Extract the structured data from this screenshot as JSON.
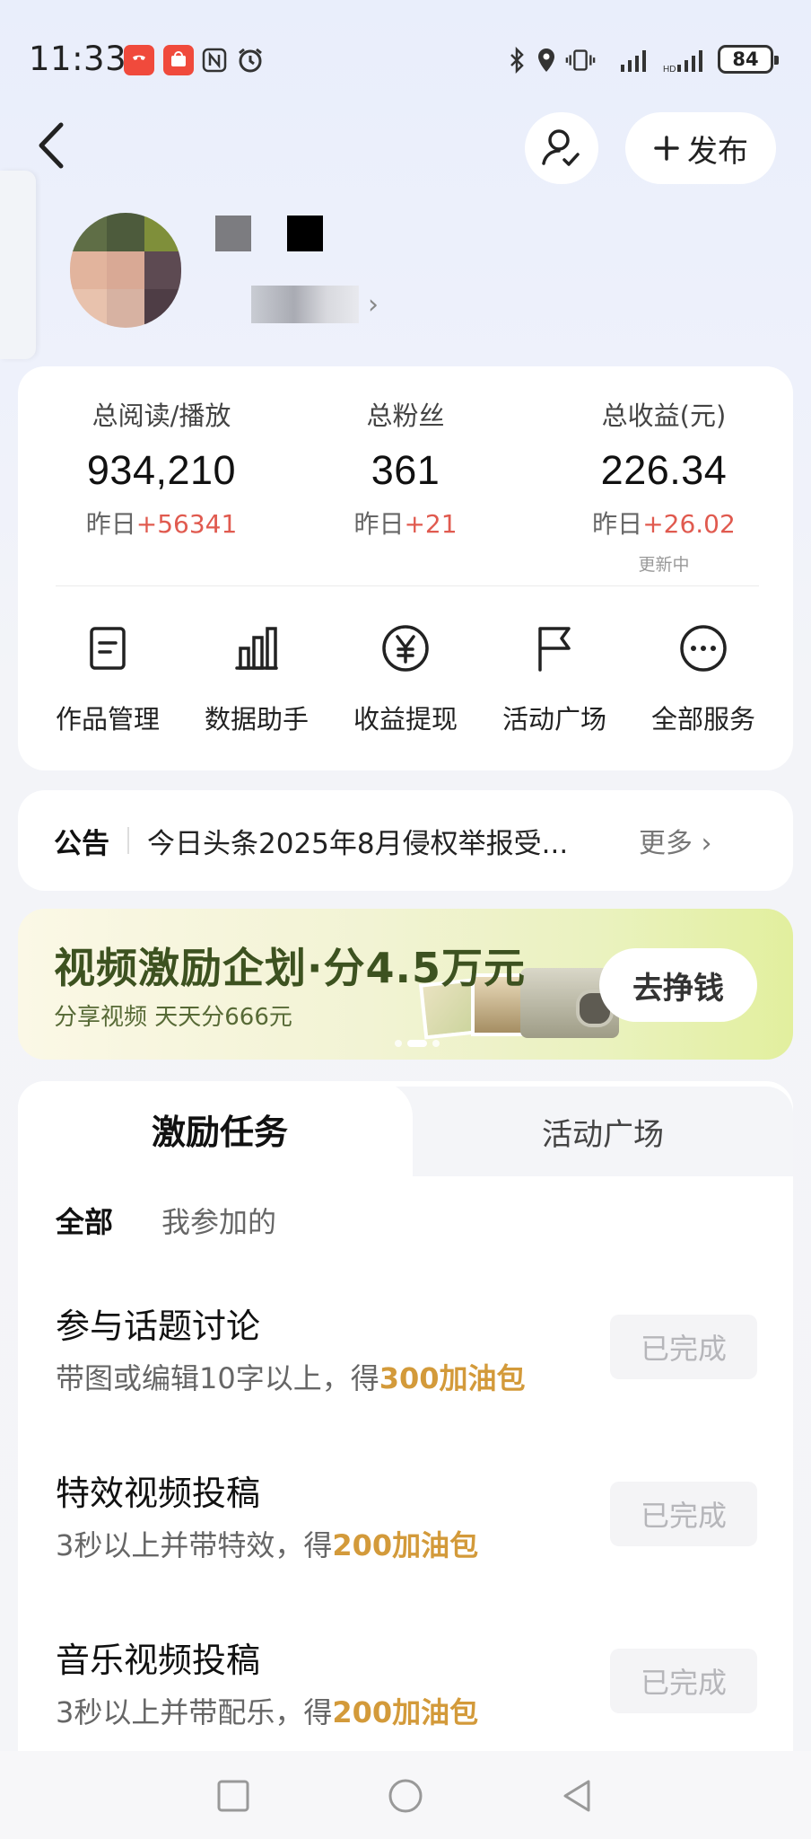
{
  "status_bar": {
    "time": "11:33",
    "battery": "84"
  },
  "header": {
    "publish_label": "发布"
  },
  "stats": [
    {
      "label": "总阅读/播放",
      "value": "934,210",
      "delta_prefix": "昨日",
      "delta": "+56341"
    },
    {
      "label": "总粉丝",
      "value": "361",
      "delta_prefix": "昨日",
      "delta": "+21"
    },
    {
      "label": "总收益(元)",
      "value": "226.34",
      "delta_prefix": "昨日",
      "delta": "+26.02"
    }
  ],
  "stats_updating": "更新中",
  "services": [
    {
      "label": "作品管理",
      "icon": "document-icon"
    },
    {
      "label": "数据助手",
      "icon": "bar-chart-icon"
    },
    {
      "label": "收益提现",
      "icon": "yen-icon"
    },
    {
      "label": "活动广场",
      "icon": "flag-icon"
    },
    {
      "label": "全部服务",
      "icon": "more-icon"
    }
  ],
  "notice": {
    "title": "公告",
    "text": "今日头条2025年8月侵权举报受...",
    "more": "更多"
  },
  "banner": {
    "title": "视频激励企划·分4.5万元",
    "subtitle": "分享视频 天天分666元",
    "button": "去挣钱"
  },
  "tabs": {
    "active": "激励任务",
    "inactive": "活动广场"
  },
  "filters": {
    "all": "全部",
    "mine": "我参加的"
  },
  "tasks": [
    {
      "title": "参与话题讨论",
      "desc": "带图或编辑10字以上，得",
      "reward": "300加油包",
      "status": "已完成"
    },
    {
      "title": "特效视频投稿",
      "desc": "3秒以上并带特效，得",
      "reward": "200加油包",
      "status": "已完成"
    },
    {
      "title": "音乐视频投稿",
      "desc": "3秒以上并带配乐，得",
      "reward": "200加油包",
      "status": "已完成"
    }
  ],
  "colors": {
    "accent_red": "#e05a4f",
    "reward_gold": "#d39a3a",
    "banner_green": "#3d5220"
  }
}
